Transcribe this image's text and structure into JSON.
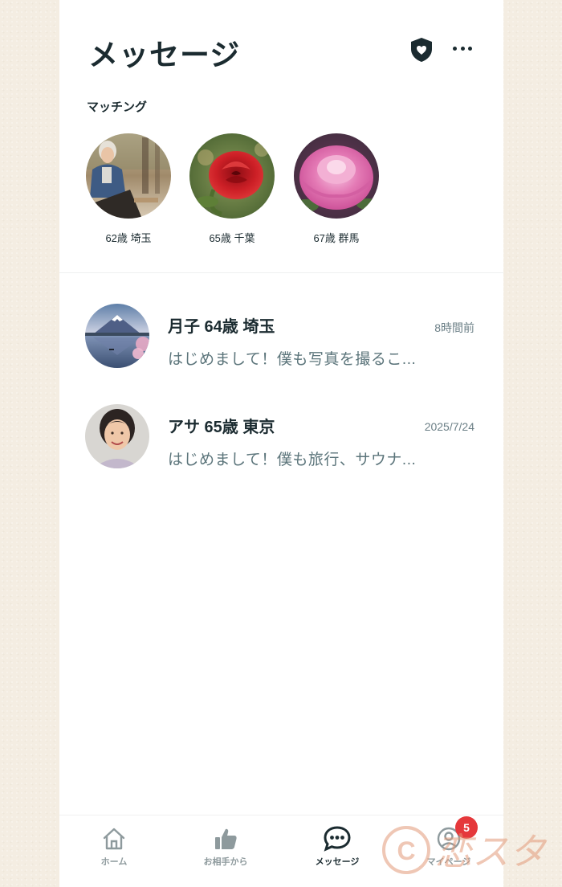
{
  "header": {
    "title": "メッセージ",
    "shield_icon": "shield-heart-icon",
    "more_icon": "more-horizontal-icon"
  },
  "matching": {
    "label": "マッチング",
    "items": [
      {
        "caption": "62歳 埼玉",
        "photo": "elderly-woman-in-park"
      },
      {
        "caption": "65歳 千葉",
        "photo": "red-rose"
      },
      {
        "caption": "67歳 群馬",
        "photo": "pink-peony"
      }
    ]
  },
  "conversations": [
    {
      "name": "月子 64歳 埼玉",
      "time": "8時間前",
      "preview": "はじめまして！僕も写真を撮るこ...",
      "photo": "mount-fuji-lake"
    },
    {
      "name": "アサ 65歳 東京",
      "time": "2025/7/24",
      "preview": "はじめまして！僕も旅行、サウナ...",
      "photo": "smiling-elderly-woman"
    }
  ],
  "nav": {
    "items": [
      {
        "label": "ホーム",
        "icon": "home-icon"
      },
      {
        "label": "お相手から",
        "icon": "thumbs-up-icon"
      },
      {
        "label": "メッセージ",
        "icon": "chat-bubble-icon"
      },
      {
        "label": "マイページ",
        "icon": "user-circle-icon"
      }
    ],
    "active": "メッセージ",
    "badge_count": "5"
  },
  "watermark": "©恋スタ",
  "colors": {
    "background": "#f4ede2",
    "text_dark": "#1b2b30",
    "text_muted": "#5c757b",
    "badge": "#e5383b"
  }
}
